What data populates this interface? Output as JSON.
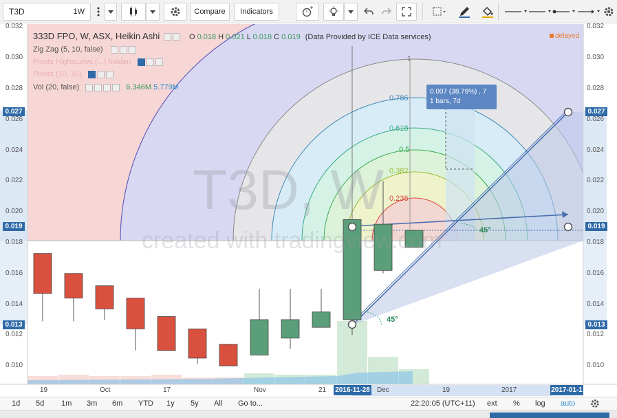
{
  "toolbar": {
    "symbol": "T3D",
    "interval": "1W",
    "compare_label": "Compare",
    "indicators_label": "Indicators"
  },
  "legend": {
    "title": "333D FPO, W, ASX, Heikin Ashi",
    "o_label": "O",
    "o_value": "0.018",
    "h_label": "H",
    "h_value": "0.021",
    "l_label": "L",
    "l_value": "0.018",
    "c_label": "C",
    "c_value": "0.019",
    "source": "(Data Provided by ICE Data services)",
    "delayed": "delayed"
  },
  "indicators": [
    {
      "label": "Zig Zag (5, 10, false)"
    },
    {
      "label": "Pivots HighsLows (...) hidden"
    },
    {
      "label": "Pivots (10, 10)"
    },
    {
      "label": "Vol (20, false)",
      "value1": "6.346M",
      "value2": "5.779M"
    }
  ],
  "watermark": {
    "big": "T3D, W",
    "small": "created with tradingview.com"
  },
  "price_axis": [
    "0.032",
    "0.030",
    "0.028",
    "0.026",
    "0.024",
    "0.022",
    "0.020",
    "0.018",
    "0.016",
    "0.014",
    "0.012",
    "0.010"
  ],
  "price_tags": {
    "upper": "0.027",
    "mid": "0.019",
    "lower": "0.013"
  },
  "fib_levels": [
    "1",
    "0.786",
    "0.618",
    "0.5",
    "0.382",
    "0.236"
  ],
  "angle_labels": {
    "upper": "45°",
    "lower": "45°"
  },
  "tooltip": {
    "line1": "0.007 (38.79%) , 7",
    "line2": "1 bars, 7d"
  },
  "x_axis": [
    "19",
    "Oct",
    "17",
    "Nov",
    "21",
    "Dec",
    "19",
    "2017"
  ],
  "x_tags": {
    "start": "2016-11-28",
    "end": "2017-01-1"
  },
  "bottom_bar": {
    "ranges": [
      "1d",
      "5d",
      "1m",
      "3m",
      "6m",
      "YTD",
      "1y",
      "5y",
      "All"
    ],
    "goto": "Go to...",
    "clock": "22:20:05 (UTC+11)",
    "ext": "ext",
    "percent": "%",
    "log": "log",
    "auto": "auto"
  },
  "colors": {
    "bull": "#5a9e7a",
    "bear": "#d9503e",
    "accent": "#2f6aa8"
  },
  "chart_data": {
    "type": "candlestick",
    "candles": [
      {
        "o": 0.0173,
        "h": 0.0173,
        "l": 0.0129,
        "c": 0.0147
      },
      {
        "o": 0.016,
        "h": 0.016,
        "l": 0.0129,
        "c": 0.0144
      },
      {
        "o": 0.0152,
        "h": 0.0152,
        "l": 0.013,
        "c": 0.0137
      },
      {
        "o": 0.0144,
        "h": 0.0144,
        "l": 0.011,
        "c": 0.0124
      },
      {
        "o": 0.0132,
        "h": 0.0132,
        "l": 0.011,
        "c": 0.011
      },
      {
        "o": 0.0124,
        "h": 0.0124,
        "l": 0.0101,
        "c": 0.0105
      },
      {
        "o": 0.0114,
        "h": 0.0114,
        "l": 0.01,
        "c": 0.01
      },
      {
        "o": 0.0107,
        "h": 0.015,
        "l": 0.0107,
        "c": 0.013
      },
      {
        "o": 0.0118,
        "h": 0.015,
        "l": 0.0111,
        "c": 0.013
      },
      {
        "o": 0.0125,
        "h": 0.015,
        "l": 0.0125,
        "c": 0.0135
      },
      {
        "o": 0.013,
        "h": 0.0195,
        "l": 0.012,
        "c": 0.0195
      },
      {
        "o": 0.0162,
        "h": 0.022,
        "l": 0.016,
        "c": 0.0192
      },
      {
        "o": 0.0177,
        "h": 0.0188,
        "l": 0.0177,
        "c": 0.0188
      }
    ],
    "volume_bars": 13,
    "ylim": [
      0.0088,
      0.0322
    ]
  }
}
